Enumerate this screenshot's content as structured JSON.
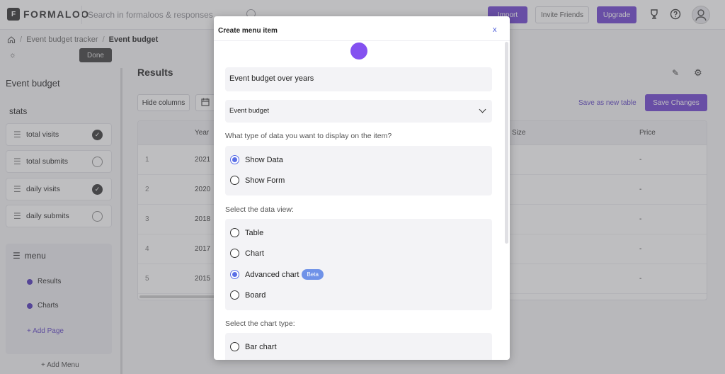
{
  "header": {
    "logo_letter": "F",
    "logo_text": "FORMALOO",
    "search_placeholder": "Search in formaloos & responses",
    "import_label": "Import",
    "invite_label": "Invite Friends",
    "upgrade_label": "Upgrade"
  },
  "breadcrumb": {
    "items": [
      "Event budget tracker",
      "Event budget"
    ]
  },
  "sidebar": {
    "done_label": "Done",
    "title": "Event budget",
    "stats_title": "stats",
    "stats": [
      {
        "label": "total visits",
        "checked": true
      },
      {
        "label": "total submits",
        "checked": false
      },
      {
        "label": "daily visits",
        "checked": true
      },
      {
        "label": "daily submits",
        "checked": false
      }
    ],
    "menu_title": "menu",
    "menu_items": [
      "Results",
      "Charts"
    ],
    "add_page_label": "+ Add Page",
    "add_menu_label": "+ Add Menu"
  },
  "main": {
    "title": "Results",
    "hide_columns_label": "Hide columns",
    "save_as_new_label": "Save as new table",
    "save_changes_label": "Save Changes",
    "table": {
      "columns": [
        "Year",
        "Size",
        "Price"
      ],
      "rows": [
        {
          "index": "1",
          "year": "2021",
          "price": "-"
        },
        {
          "index": "2",
          "year": "2020",
          "price": "-"
        },
        {
          "index": "3",
          "year": "2018",
          "price": "-"
        },
        {
          "index": "4",
          "year": "2017",
          "price": "-"
        },
        {
          "index": "5",
          "year": "2015",
          "price": "-"
        }
      ]
    }
  },
  "modal": {
    "title": "Create menu item",
    "close_label": "x",
    "name_value": "Event budget over years",
    "form_select_value": "Event budget",
    "q_data_type": "What type of data you want to display on the item?",
    "data_type_options": [
      {
        "label": "Show Data",
        "selected": true
      },
      {
        "label": "Show Form",
        "selected": false
      }
    ],
    "q_data_view": "Select the data view:",
    "data_view_options": [
      {
        "label": "Table",
        "selected": false
      },
      {
        "label": "Chart",
        "selected": false
      },
      {
        "label": "Advanced chart",
        "selected": true,
        "badge": "Beta"
      },
      {
        "label": "Board",
        "selected": false
      }
    ],
    "q_chart_type": "Select the chart type:",
    "chart_type_options": [
      {
        "label": "Bar chart",
        "selected": false
      }
    ]
  }
}
